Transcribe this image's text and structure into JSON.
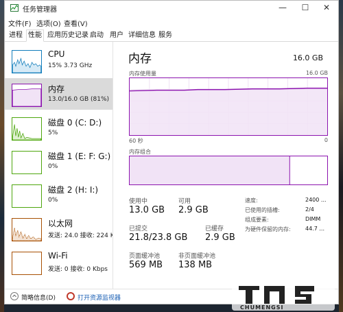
{
  "window": {
    "title": "任务管理器"
  },
  "window_controls": {
    "minimize": "—",
    "maximize": "☐",
    "close": "✕"
  },
  "menu": [
    "文件(F)",
    "选项(O)",
    "查看(V)"
  ],
  "tabs": [
    "进程",
    "性能",
    "应用历史记录",
    "启动",
    "用户",
    "详细信息",
    "服务"
  ],
  "active_tab": "性能",
  "sidebar": {
    "items": [
      {
        "name": "CPU",
        "sub": "15% 3.73 GHz",
        "color": "#117dbb"
      },
      {
        "name": "内存",
        "sub": "13.0/16.0 GB (81%)",
        "color": "#8b12ae",
        "selected": true
      },
      {
        "name": "磁盘 0 (C: D:)",
        "sub": "5%",
        "color": "#4da60c"
      },
      {
        "name": "磁盘 1 (E: F: G:)",
        "sub": "0%",
        "color": "#4da60c"
      },
      {
        "name": "磁盘 2 (H: I:)",
        "sub": "0%",
        "color": "#4da60c"
      },
      {
        "name": "以太网",
        "sub": "发送: 24.0  接收: 224 K",
        "color": "#a74f01"
      },
      {
        "name": "Wi-Fi",
        "sub": "发送: 0  接收: 0 Kbps",
        "color": "#a74f01"
      }
    ]
  },
  "memory": {
    "title": "内存",
    "capacity": "16.0 GB",
    "usage_label": "内存使用量",
    "usage_max": "16.0 GB",
    "time_left": "60 秒",
    "time_right": "0",
    "composition_label": "内存组合",
    "usage_fraction": 0.81,
    "stats": {
      "in_use_label": "使用中",
      "in_use": "13.0 GB",
      "available_label": "可用",
      "available": "2.9 GB",
      "committed_label": "已提交",
      "committed": "21.8/23.8 GB",
      "cached_label": "已缓存",
      "cached": "2.9 GB",
      "paged_label": "页面缓冲池",
      "paged": "569 MB",
      "nonpaged_label": "非页面缓冲池",
      "nonpaged": "138 MB"
    },
    "specs": [
      {
        "label": "速度:",
        "value": "2400 ..."
      },
      {
        "label": "已使用的插槽:",
        "value": "2/4"
      },
      {
        "label": "组成要素:",
        "value": "DIMM"
      },
      {
        "label": "为硬件保留的内存:",
        "value": "44.7 ..."
      }
    ]
  },
  "footer": {
    "brief": "简略信息(D)",
    "monitor": "打开资源监视器"
  },
  "watermark": {
    "brand": "CHUMENGSI"
  }
}
